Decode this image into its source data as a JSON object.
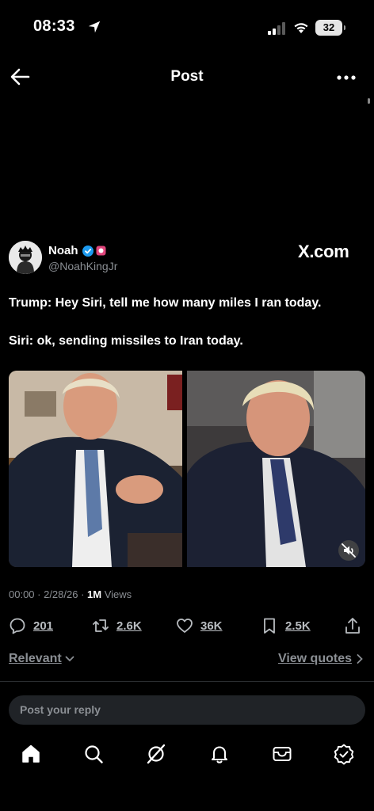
{
  "status_bar": {
    "time": "08:33",
    "battery": "32"
  },
  "nav": {
    "title": "Post"
  },
  "post": {
    "author_name": "Noah",
    "author_handle": "@NoahKingJr",
    "source_label": "X.com",
    "lines": [
      "Trump: Hey Siri, tell me how many miles I ran today.",
      "Siri: ok, sending missiles to Iran today."
    ],
    "meta": {
      "timestamp": "00:00 · 2/28/26 · ",
      "views_count": "1M",
      "views_label": " Views"
    },
    "actions": {
      "replies": "201",
      "reposts": "2.6K",
      "likes": "36K",
      "bookmarks": "2.5K"
    }
  },
  "sort": {
    "label": "Relevant",
    "view_quotes": "View quotes"
  },
  "reply_box": {
    "placeholder": "Post your reply"
  },
  "tabbar": {
    "items": [
      "home-icon",
      "search-icon",
      "grok-icon",
      "notifications-icon",
      "messages-icon",
      "verified-icon"
    ]
  },
  "colors": {
    "accent_blue": "#1d9bf0",
    "secondary_text": "#8b8f94",
    "background": "#000000"
  }
}
